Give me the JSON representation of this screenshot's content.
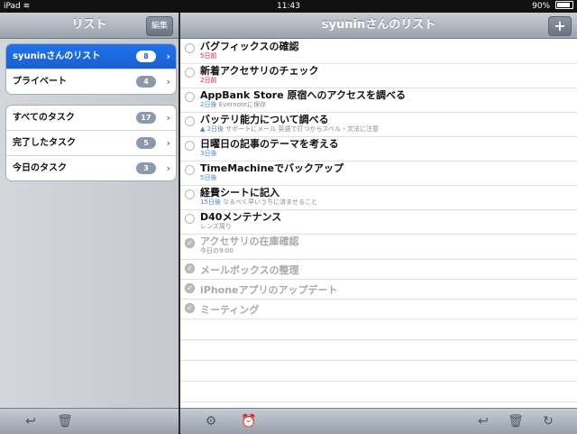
{
  "status": {
    "device": "iPad",
    "time": "11:43",
    "battery": "90%"
  },
  "left_nav": {
    "title": "リスト",
    "edit_label": "編集"
  },
  "right_nav": {
    "title": "syuninさんのリスト",
    "add_label": "+"
  },
  "lists": [
    {
      "label": "syuninさんのリスト",
      "count": "8",
      "selected": true
    },
    {
      "label": "プライベート",
      "count": "4"
    }
  ],
  "filters": [
    {
      "label": "すべてのタスク",
      "count": "17"
    },
    {
      "label": "完了したタスク",
      "count": "5"
    },
    {
      "label": "今日のタスク",
      "count": "3"
    }
  ],
  "tasks": [
    {
      "title": "バグフィックスの確認",
      "due": "5日前",
      "note": "",
      "overdue": true,
      "done": false
    },
    {
      "title": "新着アクセサリのチェック",
      "due": "2日前",
      "note": "",
      "overdue": true,
      "done": false
    },
    {
      "title": "AppBank Store 原宿へのアクセスを調べる",
      "due": "2日後",
      "note": "Evernoteに保存",
      "done": false
    },
    {
      "title": "バッテリ能力について調べる",
      "due": "▲ 2日後",
      "note": "サポートにメール 英語で打つからスペル・文法に注意",
      "done": false
    },
    {
      "title": "日曜日の記事のテーマを考える",
      "due": "3日後",
      "note": "",
      "done": false
    },
    {
      "title": "TimeMachineでバックアップ",
      "due": "5日後",
      "note": "",
      "done": false
    },
    {
      "title": "経費シートに記入",
      "due": "15日後",
      "note": "なるべく早いうちに済ませること",
      "done": false
    },
    {
      "title": "D40メンテナンス",
      "due": "",
      "note": "レンズ周り",
      "done": false
    },
    {
      "title": "アクセサリの在庫確認",
      "due": "",
      "note": "今日の9:00",
      "done": true
    },
    {
      "title": "メールボックスの整理",
      "due": "",
      "note": "",
      "done": true
    },
    {
      "title": "iPhoneアプリのアップデート",
      "due": "",
      "note": "",
      "done": true
    },
    {
      "title": "ミーティング",
      "due": "",
      "note": "",
      "done": true
    }
  ],
  "icons": {
    "reply": "↩",
    "trash": "🗑",
    "gear": "⚙",
    "alarm": "⏰",
    "refresh": "↻",
    "check": "✓",
    "chevron": "›",
    "wifi": "≋"
  }
}
